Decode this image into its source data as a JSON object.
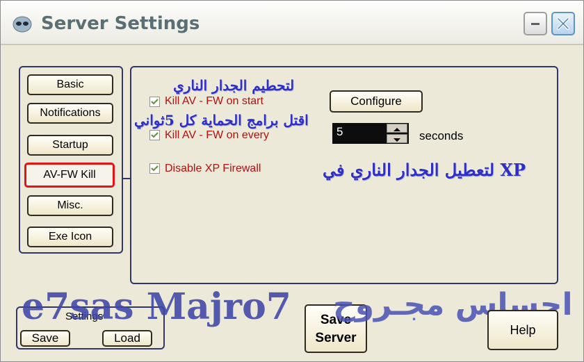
{
  "window": {
    "title": "Server Settings",
    "icon": "alien-icon"
  },
  "nav": {
    "items": [
      {
        "label": "Basic",
        "active": false
      },
      {
        "label": "Notifications",
        "active": false
      },
      {
        "label": "Startup",
        "active": false
      },
      {
        "label": "AV-FW Kill",
        "active": true
      },
      {
        "label": "Misc.",
        "active": false
      },
      {
        "label": "Exe Icon",
        "active": false
      }
    ]
  },
  "options": {
    "kill_on_start": {
      "label": "Kill AV - FW on start",
      "checked": true
    },
    "kill_every": {
      "label": "Kill AV - FW on every",
      "checked": true,
      "interval": "5",
      "unit": "seconds"
    },
    "disable_xp_firewall": {
      "label": "Disable XP Firewall",
      "checked": true
    },
    "configure_label": "Configure"
  },
  "annotations": {
    "ar1": "لتحطيم الجدار الناري",
    "ar2": "اقتل برامج الحماية كل 5ثواني",
    "ar3": "لتعطيل الجدار الناري في XP"
  },
  "settings": {
    "label": "Settings",
    "save_label": "Save",
    "load_label": "Load"
  },
  "save_server": {
    "line1": "Save",
    "line2": "Server"
  },
  "help_label": "Help",
  "watermark": {
    "en": "e7sas Majro7",
    "ar": "احساس مجـروح"
  },
  "colors": {
    "active_border": "#e51313",
    "option_text": "#b31010",
    "annotation": "#2f2fc4",
    "frame": "#30356a"
  }
}
